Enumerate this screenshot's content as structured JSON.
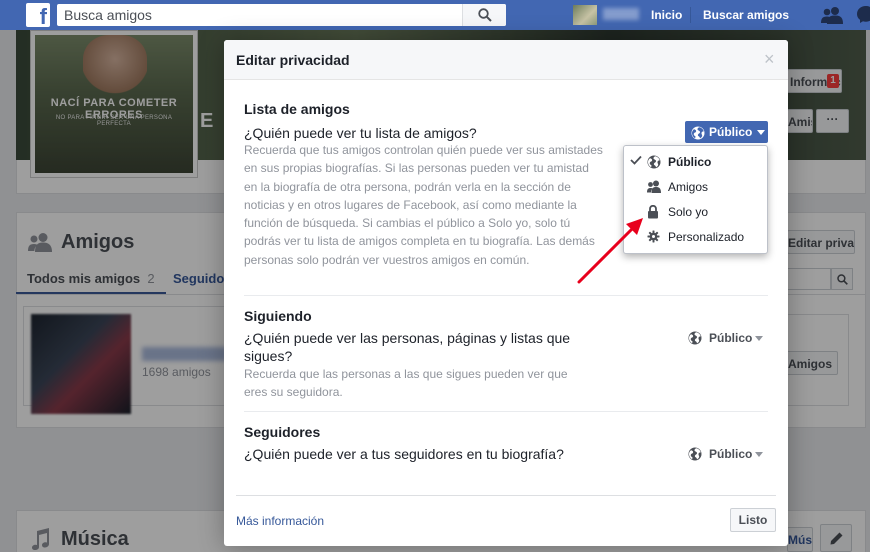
{
  "topbar": {
    "search_placeholder": "Busca amigos",
    "link_home": "Inicio",
    "link_find_friends": "Buscar amigos"
  },
  "profile": {
    "cover_text_main": "NACÍ PARA COMETER ERRORES",
    "cover_text_sub": "NO PARA FINGIR SER UNA PERSONA PERFECTA",
    "cover_letter": "E",
    "info_button": "Información",
    "info_badge": "1",
    "friend_button": "Amistad",
    "more_button": "···"
  },
  "friends_section": {
    "title": "Amigos",
    "tab_all": "Todos mis amigos",
    "tab_all_count": "2",
    "tab_following": "Seguidos",
    "privacy_button": "Editar privacidad",
    "friend_count": "1698 amigos",
    "friends_button": "Amigos"
  },
  "music_section": {
    "title": "Música",
    "button": "Música"
  },
  "modal": {
    "title": "Editar privacidad",
    "close": "×",
    "sections": [
      {
        "title": "Lista de amigos",
        "question": "¿Quién puede ver tu lista de amigos?",
        "description": "Recuerda que tus amigos controlan quién puede ver sus amistades en sus propias biografías. Si las personas pueden ver tu amistad en la biografía de otra persona, podrán verla en la sección de noticias y en otros lugares de Facebook, así como mediante la función de búsqueda. Si cambias el público a Solo yo, solo tú podrás ver tu lista de amigos completa en tu biografía. Las demás personas solo podrán ver vuestros amigos en común.",
        "audience": "Público"
      },
      {
        "title": "Siguiendo",
        "question": "¿Quién puede ver las personas, páginas y listas que sigues?",
        "description": "Recuerda que las personas a las que sigues pueden ver que eres su seguidora.",
        "audience": "Público"
      },
      {
        "title": "Seguidores",
        "question": "¿Quién puede ver a tus seguidores en tu biografía?",
        "description": "",
        "audience": "Público"
      }
    ],
    "more_info": "Más información",
    "done_button": "Listo"
  },
  "dropdown": {
    "items": [
      {
        "label": "Público",
        "icon": "globe-icon",
        "selected": true
      },
      {
        "label": "Amigos",
        "icon": "friends-icon",
        "selected": false
      },
      {
        "label": "Solo yo",
        "icon": "lock-icon",
        "selected": false
      },
      {
        "label": "Personalizado",
        "icon": "gear-icon",
        "selected": false
      }
    ]
  },
  "colors": {
    "brand": "#4267b2",
    "link": "#365899",
    "annotation_arrow": "#e8001c"
  }
}
